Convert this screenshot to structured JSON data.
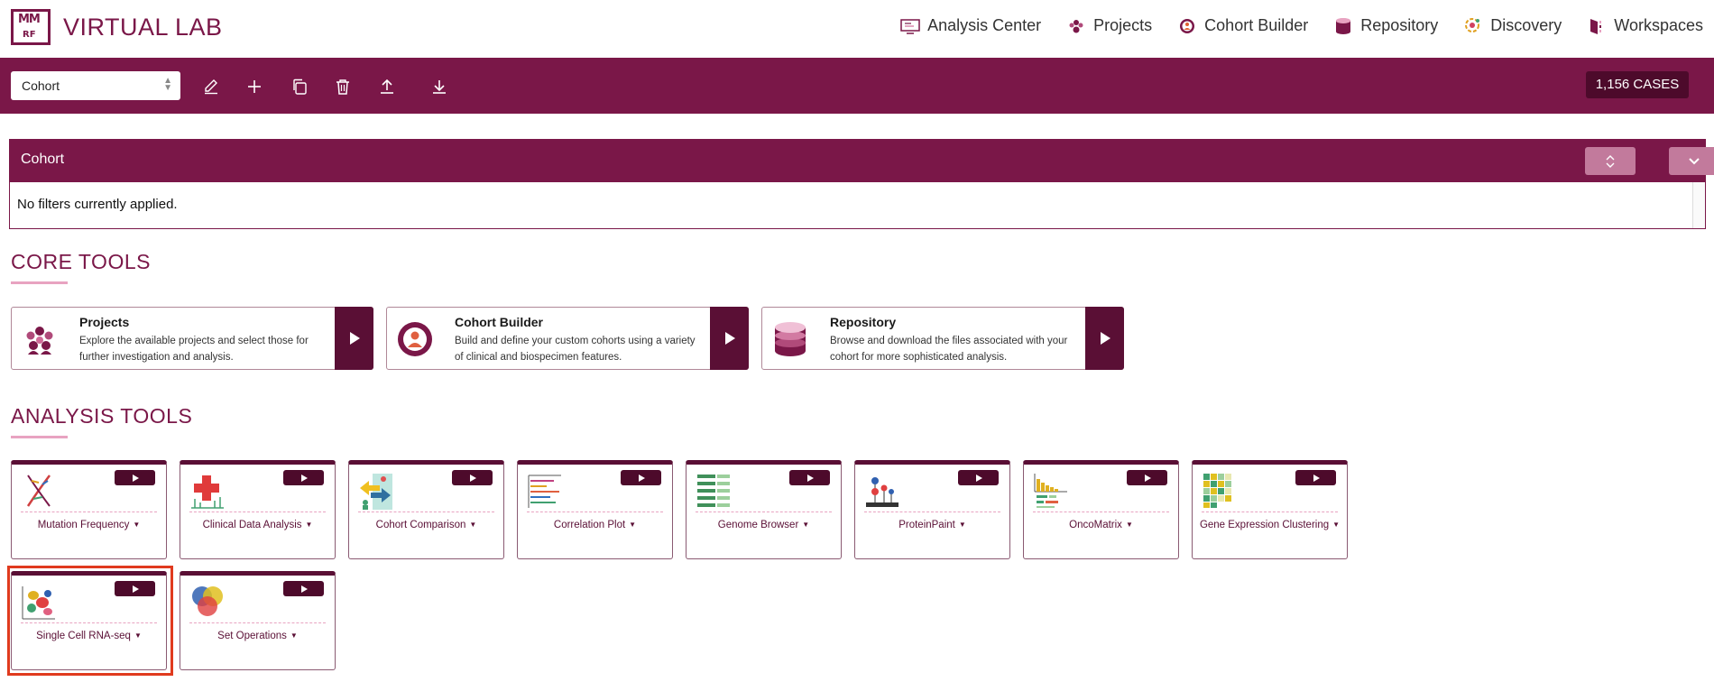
{
  "header": {
    "logo_small": "MM",
    "logo_small2": "RF",
    "logo_text": "VIRTUAL LAB",
    "nav": [
      {
        "label": "Analysis Center",
        "icon": "analysis-center-icon"
      },
      {
        "label": "Projects",
        "icon": "projects-icon"
      },
      {
        "label": "Cohort Builder",
        "icon": "cohort-builder-icon"
      },
      {
        "label": "Repository",
        "icon": "repository-icon"
      },
      {
        "label": "Discovery",
        "icon": "discovery-icon"
      },
      {
        "label": "Workspaces",
        "icon": "workspaces-icon"
      }
    ]
  },
  "toolbar": {
    "cohort_select_value": "Cohort",
    "cases_badge": "1,156 CASES",
    "buttons": [
      "edit-icon",
      "add-icon",
      "copy-icon",
      "delete-icon",
      "upload-icon",
      "download-icon"
    ]
  },
  "cohort_panel": {
    "title": "Cohort",
    "message": "No filters currently applied."
  },
  "core_tools": {
    "heading": "CORE TOOLS",
    "cards": [
      {
        "title": "Projects",
        "description": "Explore the available projects and select those for further investigation and analysis."
      },
      {
        "title": "Cohort Builder",
        "description": "Build and define your custom cohorts using a variety of clinical and biospecimen features."
      },
      {
        "title": "Repository",
        "description": "Browse and download the files associated with your cohort for more sophisticated analysis."
      }
    ]
  },
  "analysis_tools": {
    "heading": "ANALYSIS TOOLS",
    "cards": [
      {
        "label": "Mutation Frequency",
        "icon": "dna-icon"
      },
      {
        "label": "Clinical Data Analysis",
        "icon": "clinical-cross-icon"
      },
      {
        "label": "Cohort Comparison",
        "icon": "cohort-comparison-icon"
      },
      {
        "label": "Correlation Plot",
        "icon": "correlation-plot-icon"
      },
      {
        "label": "Genome Browser",
        "icon": "genome-browser-icon"
      },
      {
        "label": "ProteinPaint",
        "icon": "proteinpaint-icon"
      },
      {
        "label": "OncoMatrix",
        "icon": "oncomatrix-icon"
      },
      {
        "label": "Gene Expression Clustering",
        "icon": "heatmap-icon"
      },
      {
        "label": "Single Cell RNA-seq",
        "icon": "single-cell-icon"
      },
      {
        "label": "Set Operations",
        "icon": "venn-icon"
      }
    ]
  },
  "colors": {
    "brand": "#7a1748",
    "brand_dark": "#4d0a2b",
    "accent_pink": "#e8a3c1",
    "highlight": "#e03a1e"
  }
}
